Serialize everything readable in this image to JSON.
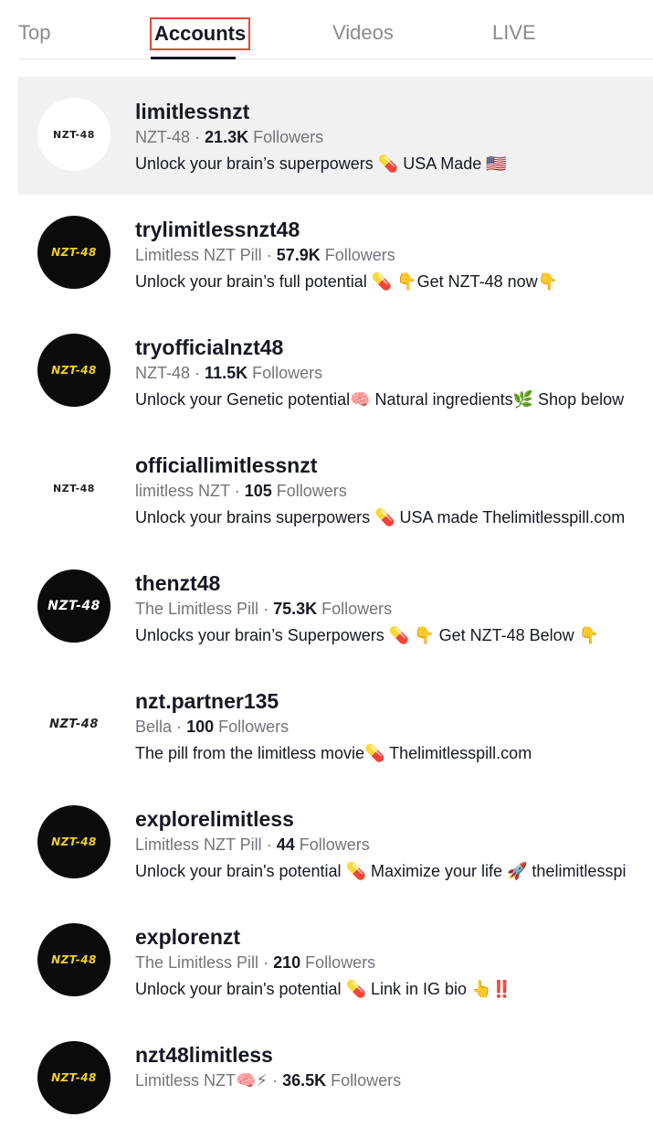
{
  "tabs": {
    "top": "Top",
    "accounts": "Accounts",
    "videos": "Videos",
    "live": "LIVE"
  },
  "accounts": [
    {
      "username": "limitlessnzt",
      "nickname": "NZT-48",
      "followers": "21.3K",
      "followers_label": "Followers",
      "bio": "Unlock your brain’s superpowers 💊 USA Made 🇺🇸",
      "logo_text": "NZT-48"
    },
    {
      "username": "trylimitlessnzt48",
      "nickname": "Limitless NZT Pill",
      "followers": "57.9K",
      "followers_label": "Followers",
      "bio": "Unlock your brain’s full potential 💊 👇Get NZT-48 now👇",
      "logo_text": "NZT-48"
    },
    {
      "username": "tryofficialnzt48",
      "nickname": "NZT-48",
      "followers": "11.5K",
      "followers_label": "Followers",
      "bio": "Unlock your Genetic potential🧠 Natural ingredients🌿 Shop below",
      "logo_text": "NZT-48"
    },
    {
      "username": "officiallimitlessnzt",
      "nickname": "limitless NZT",
      "followers": "105",
      "followers_label": "Followers",
      "bio": "Unlock your brains superpowers 💊 USA made Thelimitlesspill.com",
      "logo_text": "NZT-48"
    },
    {
      "username": "thenzt48",
      "nickname": "The Limitless Pill",
      "followers": "75.3K",
      "followers_label": "Followers",
      "bio": "Unlocks your brain’s Superpowers 💊 👇 Get NZT-48 Below 👇",
      "logo_text": "NZT-48"
    },
    {
      "username": "nzt.partner135",
      "nickname": "Bella",
      "followers": "100",
      "followers_label": "Followers",
      "bio": "The pill from the limitless movie💊 Thelimitlesspill.com",
      "logo_text": "NZT-48"
    },
    {
      "username": "explorelimitless",
      "nickname": "Limitless NZT Pill",
      "followers": "44",
      "followers_label": "Followers",
      "bio": "Unlock your brain's potential 💊 Maximize your life 🚀 thelimitlesspi",
      "logo_text": "NZT-48"
    },
    {
      "username": "explorenzt",
      "nickname": "The Limitless Pill",
      "followers": "210",
      "followers_label": "Followers",
      "bio": "Unlock your brain's potential 💊 Link in IG bio 👆‼️",
      "logo_text": "NZT-48"
    },
    {
      "username": "nzt48limitless",
      "nickname": "Limitless NZT🧠⚡",
      "followers": "36.5K",
      "followers_label": "Followers",
      "bio": "",
      "logo_text": "NZT-48"
    }
  ],
  "separator": "·",
  "colors": {
    "tab_highlight_border": "#e4473a",
    "active_tab": "#161823",
    "inactive_tab": "#8a8b91",
    "logo_yellow": "#f2d21b",
    "highlight_row": "#f1f1f2"
  },
  "icons": {
    "avatar": "nzt-48-logo"
  }
}
